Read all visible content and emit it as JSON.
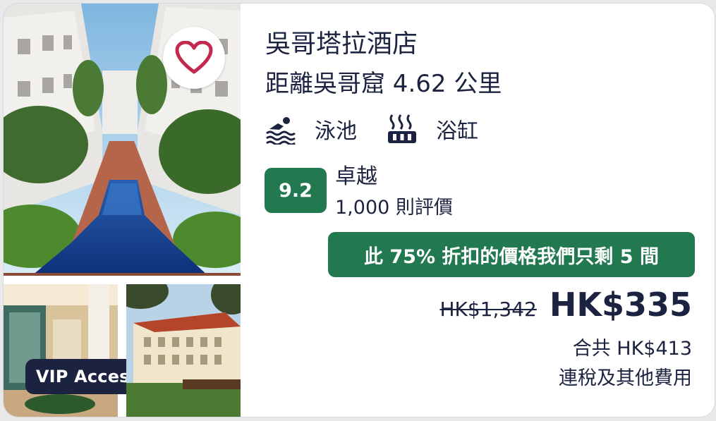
{
  "hotel": {
    "name": "吳哥塔拉酒店",
    "distance": "距離吳哥窟 4.62 公里"
  },
  "amenities": [
    {
      "icon": "pool-icon",
      "label": "泳池"
    },
    {
      "icon": "hot-tub-icon",
      "label": "浴缸"
    }
  ],
  "rating": {
    "score": "9.2",
    "word": "卓越",
    "reviews": "1,000 則評價"
  },
  "deal": {
    "text": "此 75% 折扣的價格我們只剩 5 間"
  },
  "price": {
    "original": "HK$1,342",
    "current": "HK$335",
    "total": "合共 HK$413",
    "note": "連稅及其他費用"
  },
  "badge": {
    "vip": "VIP Access"
  },
  "colors": {
    "navy": "#1b2340",
    "green": "#227950",
    "heart": "#c3294f"
  }
}
